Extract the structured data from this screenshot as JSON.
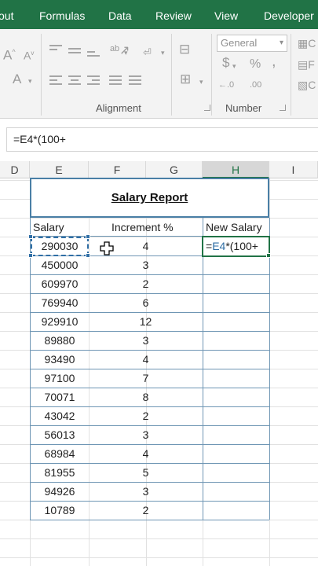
{
  "ribbon_tabs": [
    "out",
    "Formulas",
    "Data",
    "Review",
    "View",
    "Developer"
  ],
  "ribbon": {
    "font_group": {
      "grow_font": "A",
      "shrink_font": "A",
      "font_color": "A"
    },
    "alignment": {
      "label": "Alignment"
    },
    "number": {
      "format_value": "General",
      "currency": "$",
      "percent": "%",
      "comma": ",",
      "increase_decimal": "←.0",
      "decrease_decimal": ".00",
      "label": "Number"
    },
    "styles_partial": [
      "C",
      "F",
      "C"
    ]
  },
  "formula_bar": {
    "text": "=E4*(100+"
  },
  "columns": [
    "D",
    "E",
    "F",
    "G",
    "H",
    "I"
  ],
  "active_column": "H",
  "sheet": {
    "title": "Salary Report",
    "headers": {
      "salary": "Salary",
      "increment": "Increment %",
      "new_salary": "New Salary"
    },
    "rows": [
      {
        "salary": "290030",
        "increment": "4"
      },
      {
        "salary": "450000",
        "increment": "3"
      },
      {
        "salary": "609970",
        "increment": "2"
      },
      {
        "salary": "769940",
        "increment": "6"
      },
      {
        "salary": "929910",
        "increment": "12"
      },
      {
        "salary": "89880",
        "increment": "3"
      },
      {
        "salary": "93490",
        "increment": "4"
      },
      {
        "salary": "97100",
        "increment": "7"
      },
      {
        "salary": "70071",
        "increment": "8"
      },
      {
        "salary": "43042",
        "increment": "2"
      },
      {
        "salary": "56013",
        "increment": "3"
      },
      {
        "salary": "68984",
        "increment": "4"
      },
      {
        "salary": "81955",
        "increment": "5"
      },
      {
        "salary": "94926",
        "increment": "3"
      },
      {
        "salary": "10789",
        "increment": "2"
      }
    ],
    "active_cell": {
      "ref": "E4",
      "rest": "*(100+"
    }
  },
  "colors": {
    "ribbon_green": "#217346",
    "table_border": "#6f96b4",
    "copy_marquee": "#2f6ea5"
  }
}
